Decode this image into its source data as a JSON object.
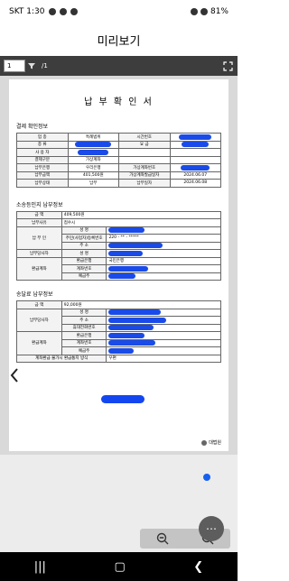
{
  "status_bar": {
    "carrier_time": "SKT 1:30",
    "battery": "81%"
  },
  "header": {
    "title": "미리보기"
  },
  "toolbar": {
    "page_value": "1",
    "page_total": "/1"
  },
  "document": {
    "title": "납 부 확 인 서",
    "section_payment": {
      "title": "결제 확인정보",
      "rows": [
        [
          "업 종",
          "특례범위",
          "시간번호",
          ""
        ],
        [
          "종 류",
          "",
          "요 금",
          ""
        ],
        [
          "사 용 자",
          "",
          "",
          ""
        ],
        [
          "결제구분",
          "가상계좌",
          "",
          ""
        ],
        [
          "납부은행",
          "우리은행",
          "가상계좌번호",
          ""
        ],
        [
          "납부금액",
          "401,500원",
          "가상계좌발급일자",
          "2024.06.07"
        ],
        [
          "납부상태",
          "납부",
          "납부일자",
          "2024.06.08"
        ]
      ]
    },
    "section_refund": {
      "title": "소송등인지 납부정보",
      "amount_label": "금 액",
      "amount_value": "409,500원",
      "reason_label": "납부사유",
      "reason_value": "접수시",
      "payer_label": "납 부 인",
      "payer_fields": [
        "성 명",
        "주민(사업자)등록번호",
        "주 소"
      ],
      "payer_id": "220 - ** - *****",
      "agent_label": "납부당사자",
      "agent_field": "성 명",
      "refund_label": "환급계좌",
      "refund_fields": [
        "환급은행",
        "계좌번호",
        "예금주"
      ],
      "refund_bank": "국민은행"
    },
    "section_deposit": {
      "title": "송달료 납부정보",
      "amount_label": "금 액",
      "amount_value": "92,000원",
      "agent_label": "납부당사자",
      "agent_fields": [
        "성 명",
        "주 소",
        "휴대전화번호"
      ],
      "refund_label": "환급계좌",
      "refund_fields": [
        "환급은행",
        "계좌번호",
        "예금주"
      ],
      "notice_label": "계좌환급 불가시 환급통지 방식",
      "notice_value": "우편"
    },
    "footer_brand": "대법원"
  }
}
